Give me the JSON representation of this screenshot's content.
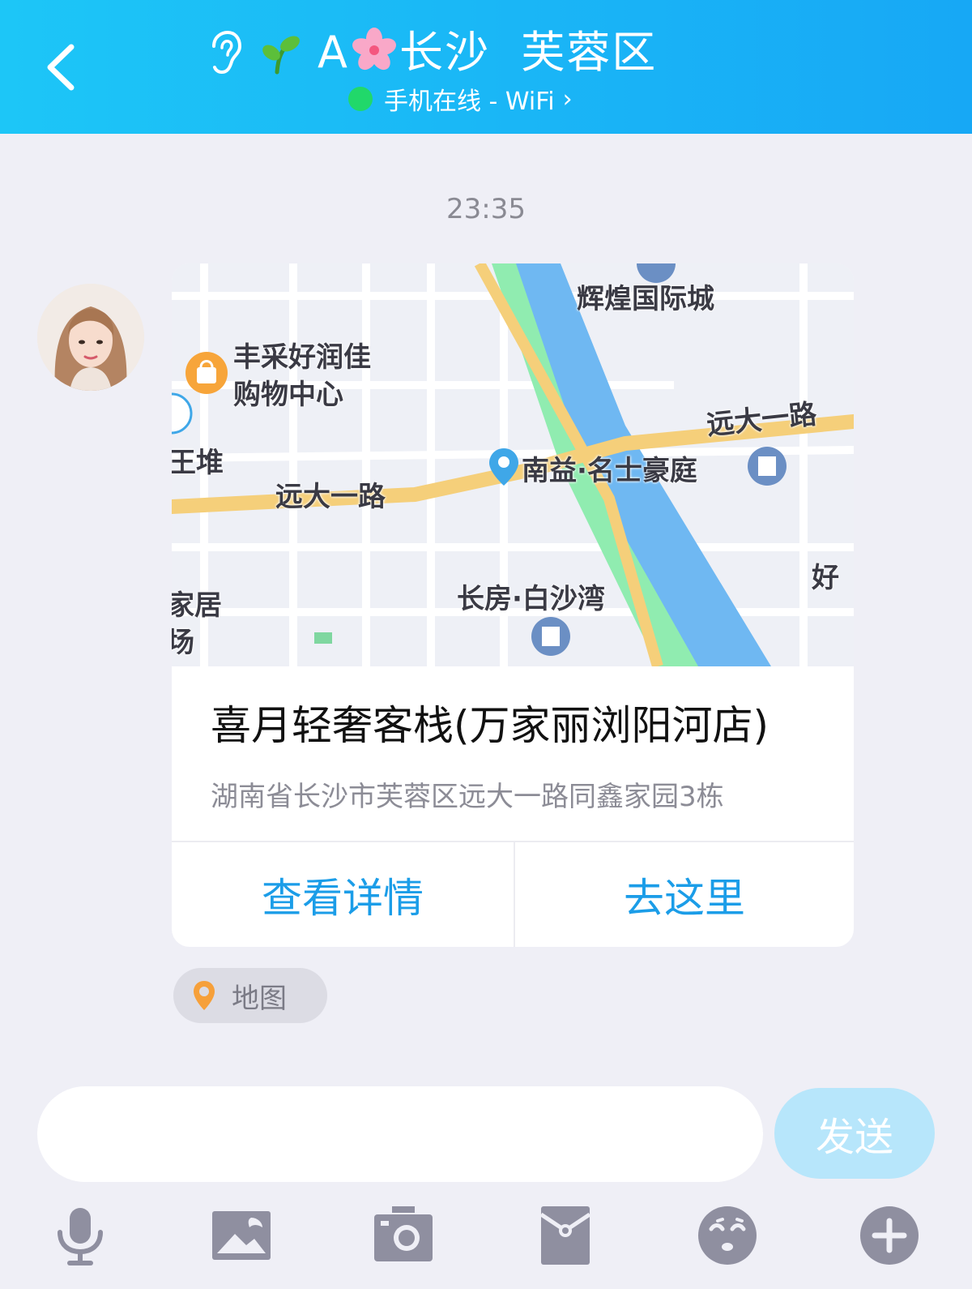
{
  "header": {
    "name_left": "A",
    "name_right": "长沙  芙蓉区",
    "status_text": "手机在线 - WiFi",
    "status_arrow": "›",
    "back_icon": "chevron-left-icon",
    "ear_icon": "ear-icon",
    "sprout_icon": "sprout-emoji",
    "flower_icon": "cherry-blossom-emoji"
  },
  "chat": {
    "timestamp": "23:35",
    "message": {
      "map_labels": {
        "label_1": "辉煌国际城",
        "label_2": "丰采好润佳",
        "label_3": "购物中心",
        "label_4": "远大一路",
        "label_5": "王堆",
        "label_6": "远大一路",
        "label_7": "南益·名士豪庭",
        "label_8": "好",
        "label_9": "长房·白沙湾",
        "label_10": "家居",
        "label_11": "场"
      },
      "place_title": "喜月轻奢客栈(万家丽浏阳河店)",
      "place_address": "湖南省长沙市芙蓉区远大一路同鑫家园3栋",
      "details_button": "查看详情",
      "go_button": "去这里",
      "tag_label": "地图"
    }
  },
  "input_bar": {
    "placeholder": "",
    "send_label": "发送",
    "toolbar_icons": [
      "microphone-icon",
      "image-icon",
      "camera-icon",
      "red-packet-icon",
      "emoji-icon",
      "plus-icon"
    ]
  },
  "colors": {
    "header_start": "#1dc6f7",
    "header_end": "#17a8f5",
    "accent": "#1b9de8",
    "send_disabled": "#b7e6fb",
    "icon_gray": "#8f8fa0",
    "background": "#efeff6"
  }
}
